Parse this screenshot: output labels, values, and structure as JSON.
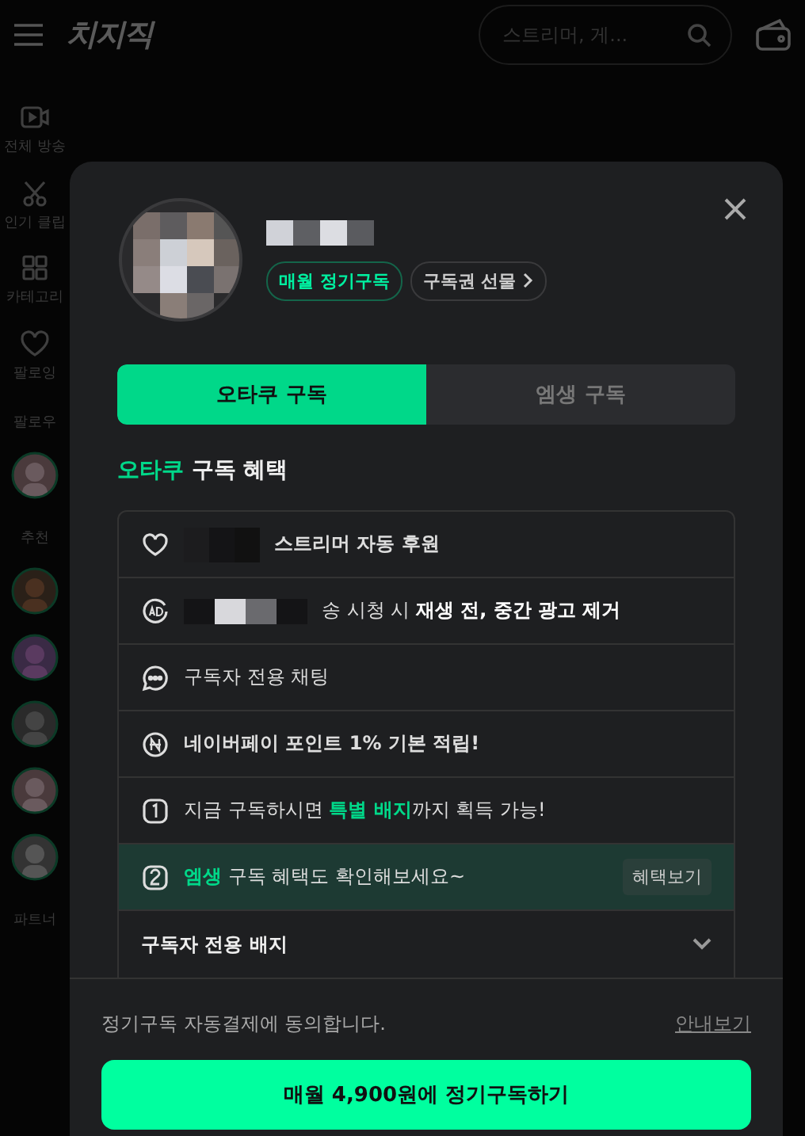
{
  "top_bar": {
    "logo": "치지직",
    "search": {
      "placeholder": "스트리머, 게..."
    }
  },
  "sidebar": {
    "nav": [
      {
        "kind": "video",
        "label": "전체 방송"
      },
      {
        "kind": "clip",
        "label": "인기 클립"
      },
      {
        "kind": "grid",
        "label": "카테고리"
      },
      {
        "kind": "heart",
        "label": "팔로잉"
      }
    ],
    "sections": [
      {
        "title": "팔로우"
      },
      {
        "title": "추천"
      },
      {
        "title": "파트너"
      }
    ]
  },
  "modal": {
    "badges": [
      {
        "label": "매월 정기구독",
        "kind": "status"
      },
      {
        "label": "구독권 선물",
        "kind": "link"
      }
    ],
    "tabs": [
      {
        "label": "오타쿠 구독",
        "selected": true
      },
      {
        "label": "엠생 구독",
        "selected": false
      }
    ],
    "benefits_title": "**오타쿠** 구독 혜택",
    "benefits": [
      {
        "kind": "heart",
        "masked": true,
        "text": "스트리머 자동 후원",
        "bold": true,
        "highlighted": false
      },
      {
        "kind": "ad",
        "masked": true,
        "text": "송 시청 시 **재생 전, 중간 광고 제거**",
        "bold": false,
        "highlighted": false
      },
      {
        "kind": "chat",
        "masked": false,
        "text": "구독자 전용 채팅",
        "bold": false,
        "highlighted": false
      },
      {
        "kind": "npay",
        "masked": false,
        "text": "네이버페이 포인트 1% 기본 적립!",
        "bold": true,
        "highlighted": false
      },
      {
        "kind": "one",
        "masked": false,
        "text": "지금 구독하시면 **특별 배지**까지 획득 가능!",
        "bold": false,
        "highlighted": false,
        "accent": true
      },
      {
        "kind": "two",
        "masked": false,
        "text": "**엠생** 구독 혜택도 확인해보세요~",
        "bold": false,
        "highlighted": true,
        "accent": true,
        "action": "혜택보기"
      }
    ],
    "accordion": {
      "label": "구독자 전용 배지",
      "expanded": false
    },
    "footer": {
      "agreement": "정기구독 자동결제에 동의합니다.",
      "link": "안내보기",
      "button": "매월 4,900원에 정기구독하기"
    }
  }
}
